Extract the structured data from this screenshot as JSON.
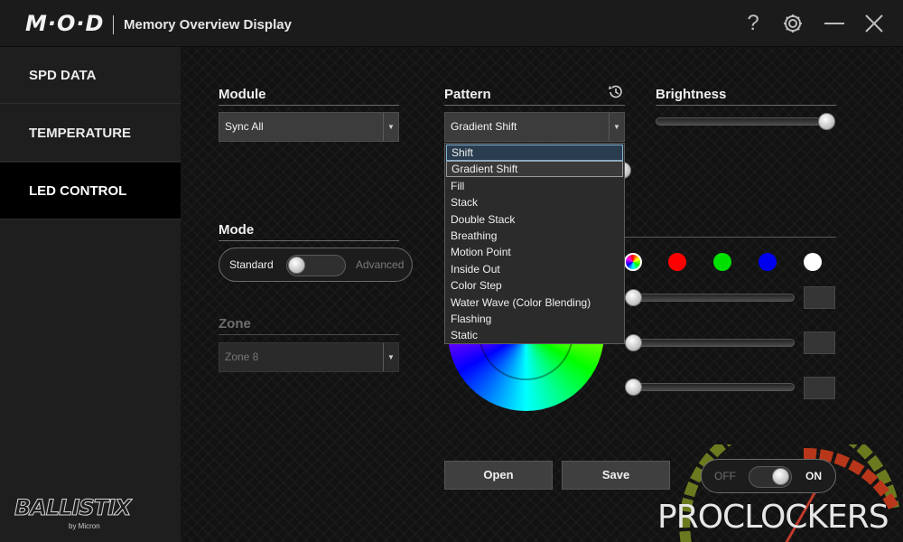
{
  "window": {
    "brand": "M·O·D",
    "title": "Memory Overview Display"
  },
  "sidebar": {
    "items": [
      {
        "label": "SPD DATA",
        "active": false
      },
      {
        "label": "TEMPERATURE",
        "active": false
      },
      {
        "label": "LED CONTROL",
        "active": true
      }
    ],
    "logo": "BALLISTIX",
    "logo_sub": "by Micron"
  },
  "module": {
    "label": "Module",
    "value": "Sync All"
  },
  "pattern": {
    "label": "Pattern",
    "value": "Gradient Shift",
    "options": [
      "Shift",
      "Gradient Shift",
      "Fill",
      "Stack",
      "Double Stack",
      "Breathing",
      "Motion Point",
      "Inside Out",
      "Color Step",
      "Water Wave (Color Blending)",
      "Flashing",
      "Static"
    ],
    "hovered_option": "Shift",
    "selected_option": "Gradient Shift"
  },
  "brightness": {
    "label": "Brightness",
    "level": 1.0
  },
  "mode": {
    "label": "Mode",
    "standard_label": "Standard",
    "advanced_label": "Advanced",
    "current": "Standard"
  },
  "zone": {
    "label": "Zone",
    "value": "Zone 8",
    "enabled": false
  },
  "colors": {
    "swatches": [
      "rainbow",
      "#ff0000",
      "#00e000",
      "#0000ee",
      "#ffffff"
    ]
  },
  "rgb_sliders": [
    {
      "level": 0.0
    },
    {
      "level": 0.0
    },
    {
      "level": 0.0
    }
  ],
  "buttons": {
    "open_label": "Open",
    "save_label": "Save"
  },
  "power": {
    "off_label": "OFF",
    "on_label": "ON",
    "state": "ON"
  },
  "watermark": "PROCLOCKERS"
}
